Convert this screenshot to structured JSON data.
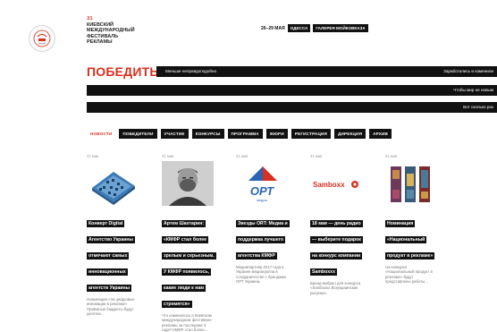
{
  "festival": {
    "number": "31",
    "line1": "КИЕВСКИЙ",
    "line2": "МЕЖДУНАРОДНЫЙ",
    "line3": "ФЕСТИВАЛЬ",
    "line4": "РЕКЛАМЫ"
  },
  "header": {
    "dates": "26–29 МАЯ",
    "pill_1": "ОДЕССА",
    "pill_2": "ГАЛЕРЕЯ МОЙКОВКАЗА"
  },
  "headline": "ПОБЕДИТЬ",
  "ticker": {
    "left": "Меньше неправдоподобно",
    "right": "Заработались и изменили"
  },
  "bar2_text": "Чтобы мир не новым",
  "bar3_text": "Вот сколько раз",
  "nav": [
    "НОВОСТИ",
    "ПОБЕДИТЕЛИ",
    "УЧАСТИЕ",
    "КОНКУРСЫ",
    "ПРОГРАММА",
    "ЖЮРИ",
    "РЕГИСТРАЦИЯ",
    "ДИРЕКЦИЯ",
    "АРХИВ"
  ],
  "cards": [
    {
      "date": "31 мая",
      "title": "Конверт Digital Агентство Украины отмечают самых инновационных агентств Украины",
      "desc": "Номинация «За цифровые инновации в рекламе» Приёмные бюджеты будут десятки."
    },
    {
      "date": "31 мая",
      "title": "Артем Шахтарин: «КМФР стал более зрелым и серьезным. У КМФР появилось, какие люди к нам стремятся»",
      "desc": "Что изменилось в Киевском международном фестивале рекламы за последние 3 года? КМФР стал более..."
    },
    {
      "date": "31 мая",
      "title": "Звезды ORT: Медиа и поддержка лучшего агентства КМФР",
      "desc": "Медиапартнёр 2017 года в Украине медиагруппа в сотрудничестве с брендами ОРТ Украина."
    },
    {
      "date": "31 мая",
      "title": "18 мая — день радио — выберите подарок на конкурс компании Samboxxx",
      "desc": "Бренд выбрал для конкурса «Samboxxx Всеукраинские рисунки»."
    },
    {
      "date": "31 мая",
      "title": "Номинация «Национальный продукт в рекламе»",
      "desc": "На конкурсе «Национальный продукт в рекламе» будут представлены работы..."
    }
  ]
}
